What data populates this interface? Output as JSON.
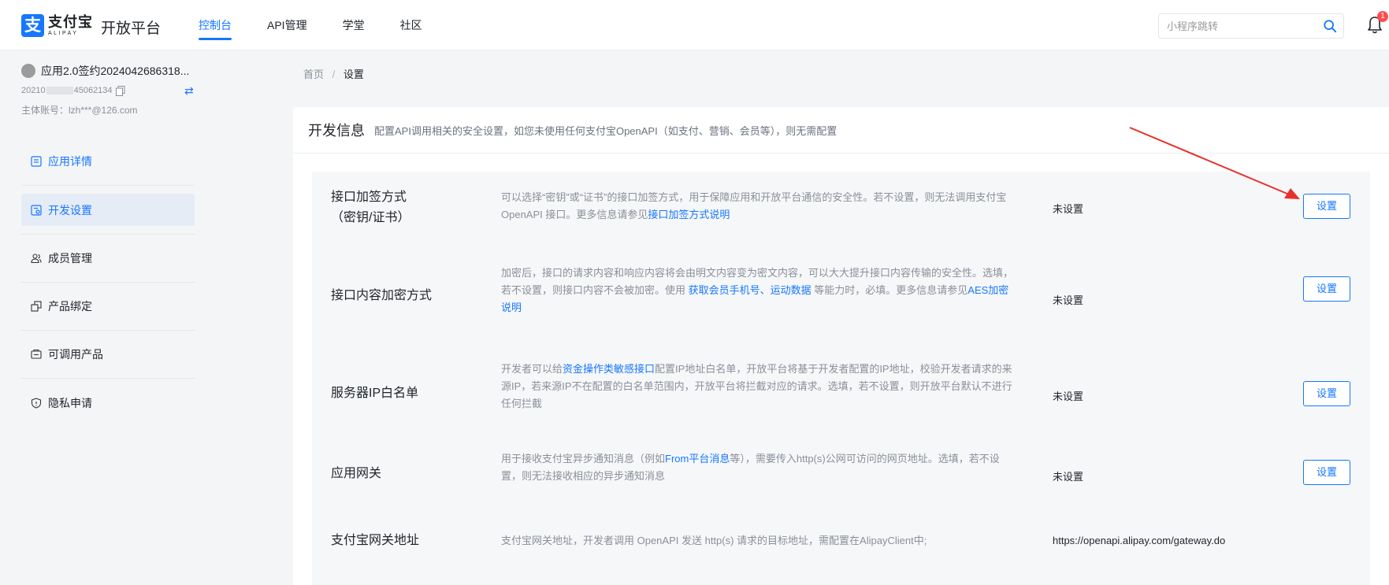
{
  "header": {
    "logo_cn": "支付宝",
    "logo_en": "ALIPAY",
    "platform_title": "开放平台",
    "nav": [
      {
        "label": "控制台",
        "active": true
      },
      {
        "label": "API管理",
        "active": false
      },
      {
        "label": "学堂",
        "active": false
      },
      {
        "label": "社区",
        "active": false
      }
    ],
    "search_placeholder": "小程序跳转",
    "notification_count": "1"
  },
  "sidebar": {
    "app_name": "应用2.0签约2024042686318...",
    "app_id_prefix": "20210",
    "app_id_suffix": "45062134",
    "account": "主体账号：lzh***@126.com",
    "menu": [
      {
        "label": "应用详情",
        "icon": "app-detail-icon"
      },
      {
        "label": "开发设置",
        "icon": "dev-settings-icon",
        "active": true
      },
      {
        "label": "成员管理",
        "icon": "members-icon"
      },
      {
        "label": "产品绑定",
        "icon": "product-bind-icon"
      },
      {
        "label": "可调用产品",
        "icon": "callable-products-icon"
      },
      {
        "label": "隐私申请",
        "icon": "privacy-icon"
      }
    ]
  },
  "breadcrumb": {
    "home": "首页",
    "separator": "/",
    "current": "设置"
  },
  "panel": {
    "title": "开发信息",
    "description": "配置API调用相关的安全设置，如您未使用任何支付宝OpenAPI（如支付、营销、会员等），则无需配置"
  },
  "rows": [
    {
      "name_line1": "接口加签方式",
      "name_line2": "（密钥/证书）",
      "desc_a": "可以选择“密钥”或“证书”的接口加签方式，用于保障应用和开放平台通信的安全性。若不设置，则无法调用支付宝 OpenAPI 接口。更多信息请参见",
      "desc_link": "接口加签方式说明",
      "status": "未设置",
      "button": "设置"
    },
    {
      "name": "接口内容加密方式",
      "desc_a": "加密后，接口的请求内容和响应内容将会由明文内容变为密文内容，可以大大提升接口内容传输的安全性。选填，若不设置，则接口内容不会被加密。使用 ",
      "desc_link1": "获取会员手机号",
      "desc_sep": "、",
      "desc_link2": "运动数据",
      "desc_b": " 等能力时，必填。更多信息请参见",
      "desc_link3": "AES加密说明",
      "status": "未设置",
      "button": "设置"
    },
    {
      "name": "服务器IP白名单",
      "desc_a": "开发者可以给",
      "desc_link": "资金操作类敏感接口",
      "desc_b": "配置IP地址白名单，开放平台将基于开发者配置的IP地址，校验开发者请求的来源IP，若来源IP不在配置的白名单范围内，开放平台将拦截对应的请求。选填，若不设置，则开放平台默认不进行任何拦截",
      "status": "未设置",
      "button": "设置"
    },
    {
      "name": "应用网关",
      "desc_a": "用于接收支付宝异步通知消息（例如",
      "desc_link": "From平台消息",
      "desc_b": "等），需要传入http(s)公网可访问的网页地址。选填，若不设置，则无法接收相应的异步通知消息",
      "status": "未设置",
      "button": "设置"
    },
    {
      "name": "支付宝网关地址",
      "desc_a": "支付宝网关地址，开发者调用 OpenAPI 发送 http(s) 请求的目标地址，需配置在AlipayClient中;",
      "status": "https://openapi.alipay.com/gateway.do"
    }
  ],
  "colors": {
    "accent": "#1677ff",
    "annotation_arrow": "#e8302a",
    "badge": "#ff4d4f"
  }
}
